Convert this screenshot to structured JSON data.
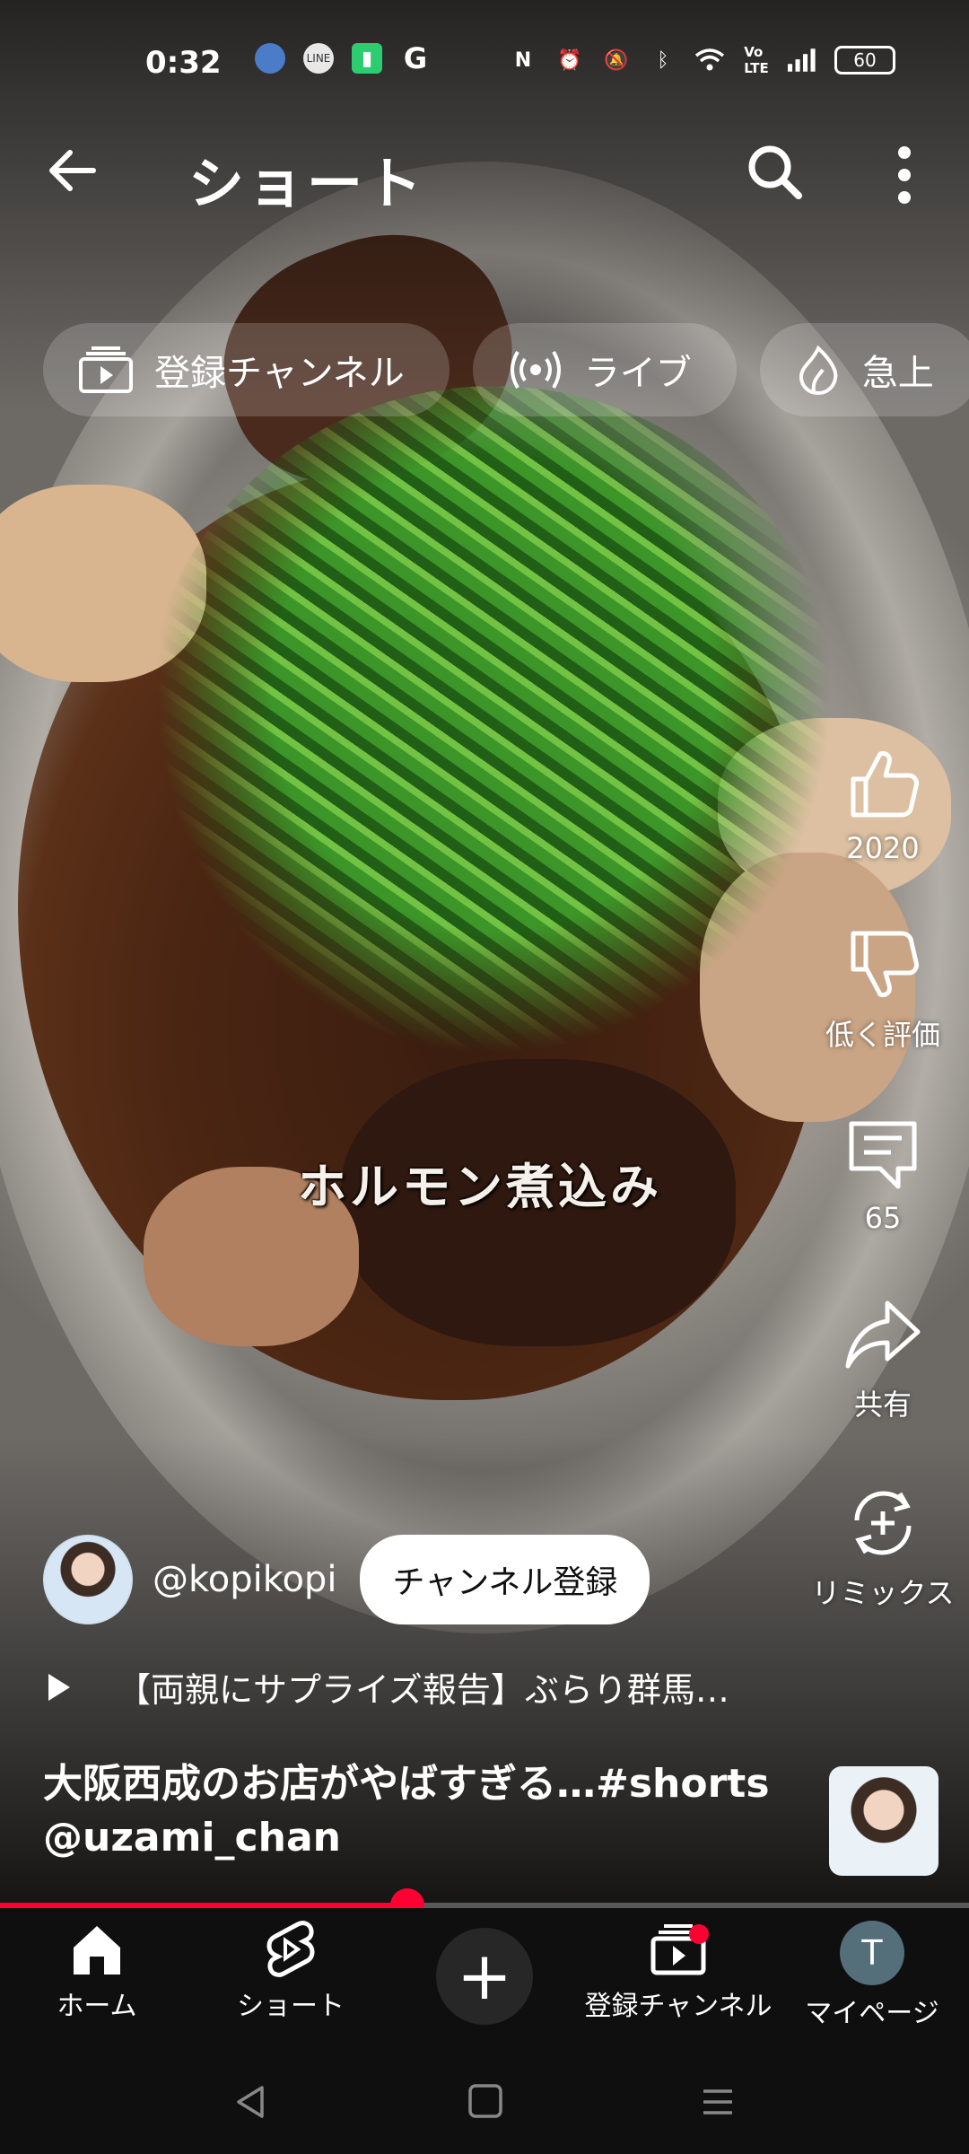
{
  "status_bar": {
    "time": "0:32",
    "left_icons": [
      "profile-notification-icon",
      "line-icon",
      "battery-saver-icon",
      "google-icon"
    ],
    "right_icons": [
      "nfc-icon",
      "alarm-icon",
      "mute-icon",
      "bluetooth-icon",
      "wifi-icon",
      "volte-icon",
      "signal-icon"
    ],
    "battery": "60"
  },
  "header": {
    "title": "ショート"
  },
  "chips": [
    {
      "label": "登録チャンネル",
      "icon": "subscriptions-icon"
    },
    {
      "label": "ライブ",
      "icon": "live-icon"
    },
    {
      "label": "急上",
      "icon": "trending-icon"
    }
  ],
  "video": {
    "caption": "ホルモン煮込み"
  },
  "actions": {
    "like_count": "2020",
    "dislike_label": "低く評価",
    "comment_count": "65",
    "share_label": "共有",
    "remix_label": "リミックス"
  },
  "channel": {
    "handle": "@kopikopi",
    "subscribe_label": "チャンネル登録"
  },
  "related": {
    "title": "【両親にサプライズ報告】ぶらり群馬…"
  },
  "description": {
    "line1": "大阪西成のお店がやばすぎる…#shorts",
    "line2": "@uzami_chan"
  },
  "progress": {
    "fraction": 0.42
  },
  "bottom_nav": {
    "home": "ホーム",
    "shorts": "ショート",
    "subscriptions": "登録チャンネル",
    "mypage": "マイページ",
    "avatar_initial": "T"
  },
  "colors": {
    "accent": "#ff0033",
    "nav_bg": "#0f0f0f",
    "avatar_bg": "#546e7a"
  }
}
